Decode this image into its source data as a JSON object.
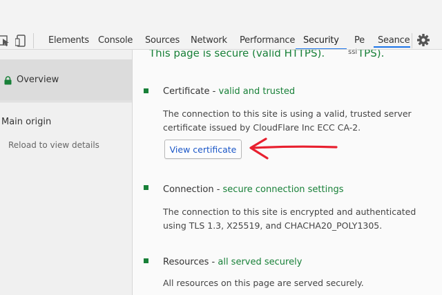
{
  "toolbar": {
    "tabs": [
      {
        "label": "Elements"
      },
      {
        "label": "Console"
      },
      {
        "label": "Sources"
      },
      {
        "label": "Network"
      },
      {
        "label": "Performance"
      },
      {
        "label": "Security",
        "active": true
      },
      {
        "label": "Pe"
      },
      {
        "label": "Seance"
      }
    ],
    "overlay_text": "ssl",
    "accent_color": "#1a73e8"
  },
  "sidebar": {
    "overview_label": "Overview",
    "main_origin_label": "Main origin",
    "reload_hint": "Reload to view details"
  },
  "main": {
    "headline": "This page is secure (valid HTTPS).",
    "headline_tail": "TPS).",
    "sections": [
      {
        "title": "Certificate",
        "separator": " - ",
        "status": "valid and trusted",
        "description": "The connection to this site is using a valid, trusted server certificate issued by CloudFlare Inc ECC CA-2.",
        "button_label": "View certificate"
      },
      {
        "title": "Connection",
        "separator": " - ",
        "status": "secure connection settings",
        "description": "The connection to this site is encrypted and authenticated using TLS 1.3, X25519, and CHACHA20_POLY1305."
      },
      {
        "title": "Resources",
        "separator": " - ",
        "status": "all served securely",
        "description": "All resources on this page are served securely."
      }
    ],
    "secure_color": "#188038",
    "annotation_arrow_color": "#e8202f"
  }
}
